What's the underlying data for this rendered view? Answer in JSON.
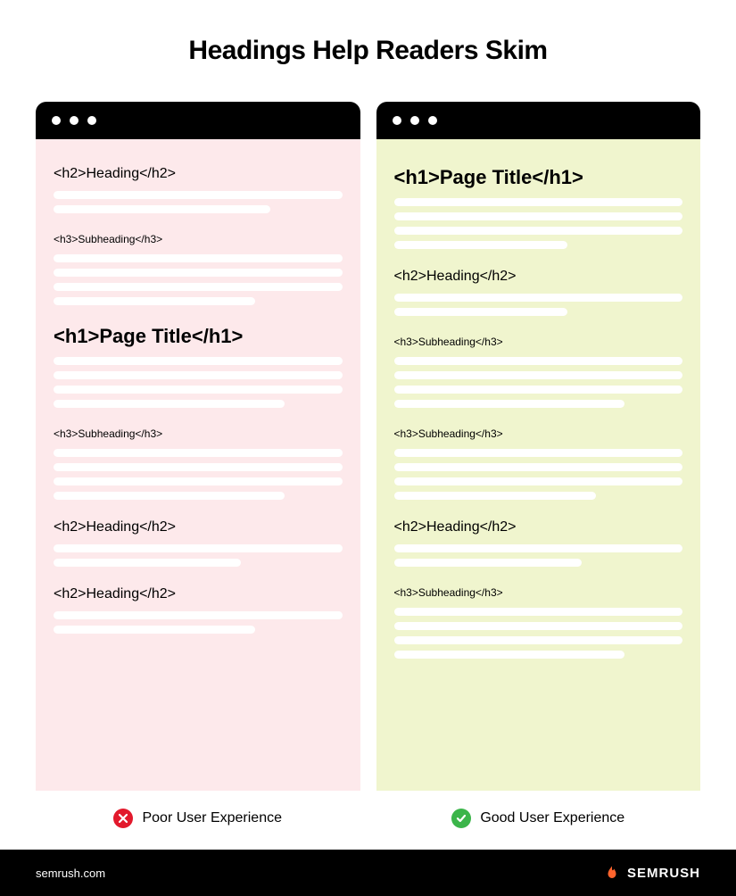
{
  "title": "Headings Help Readers Skim",
  "left": {
    "caption": "Poor User Experience",
    "items": [
      {
        "level": "h2",
        "text": "<h2>Heading</h2>",
        "bars": [
          100,
          75
        ]
      },
      {
        "level": "h3",
        "text": "<h3>Subheading</h3>",
        "bars": [
          100,
          100,
          100,
          70
        ]
      },
      {
        "level": "h1",
        "text": "<h1>Page Title</h1>",
        "bars": [
          100,
          100,
          100,
          80
        ]
      },
      {
        "level": "h3",
        "text": "<h3>Subheading</h3>",
        "bars": [
          100,
          100,
          100,
          80
        ]
      },
      {
        "level": "h2",
        "text": "<h2>Heading</h2>",
        "bars": [
          100,
          65
        ]
      },
      {
        "level": "h2",
        "text": "<h2>Heading</h2>",
        "bars": [
          100,
          70
        ]
      }
    ]
  },
  "right": {
    "caption": "Good User Experience",
    "items": [
      {
        "level": "h1",
        "text": "<h1>Page Title</h1>",
        "bars": [
          100,
          100,
          100,
          60
        ]
      },
      {
        "level": "h2",
        "text": "<h2>Heading</h2>",
        "bars": [
          100,
          60
        ]
      },
      {
        "level": "h3",
        "text": "<h3>Subheading</h3>",
        "bars": [
          100,
          100,
          100,
          80
        ]
      },
      {
        "level": "h3",
        "text": "<h3>Subheading</h3>",
        "bars": [
          100,
          100,
          100,
          70
        ]
      },
      {
        "level": "h2",
        "text": "<h2>Heading</h2>",
        "bars": [
          100,
          65
        ]
      },
      {
        "level": "h3",
        "text": "<h3>Subheading</h3>",
        "bars": [
          100,
          100,
          100,
          80
        ]
      }
    ]
  },
  "footer": {
    "url": "semrush.com",
    "brand": "SEMRUSH"
  }
}
